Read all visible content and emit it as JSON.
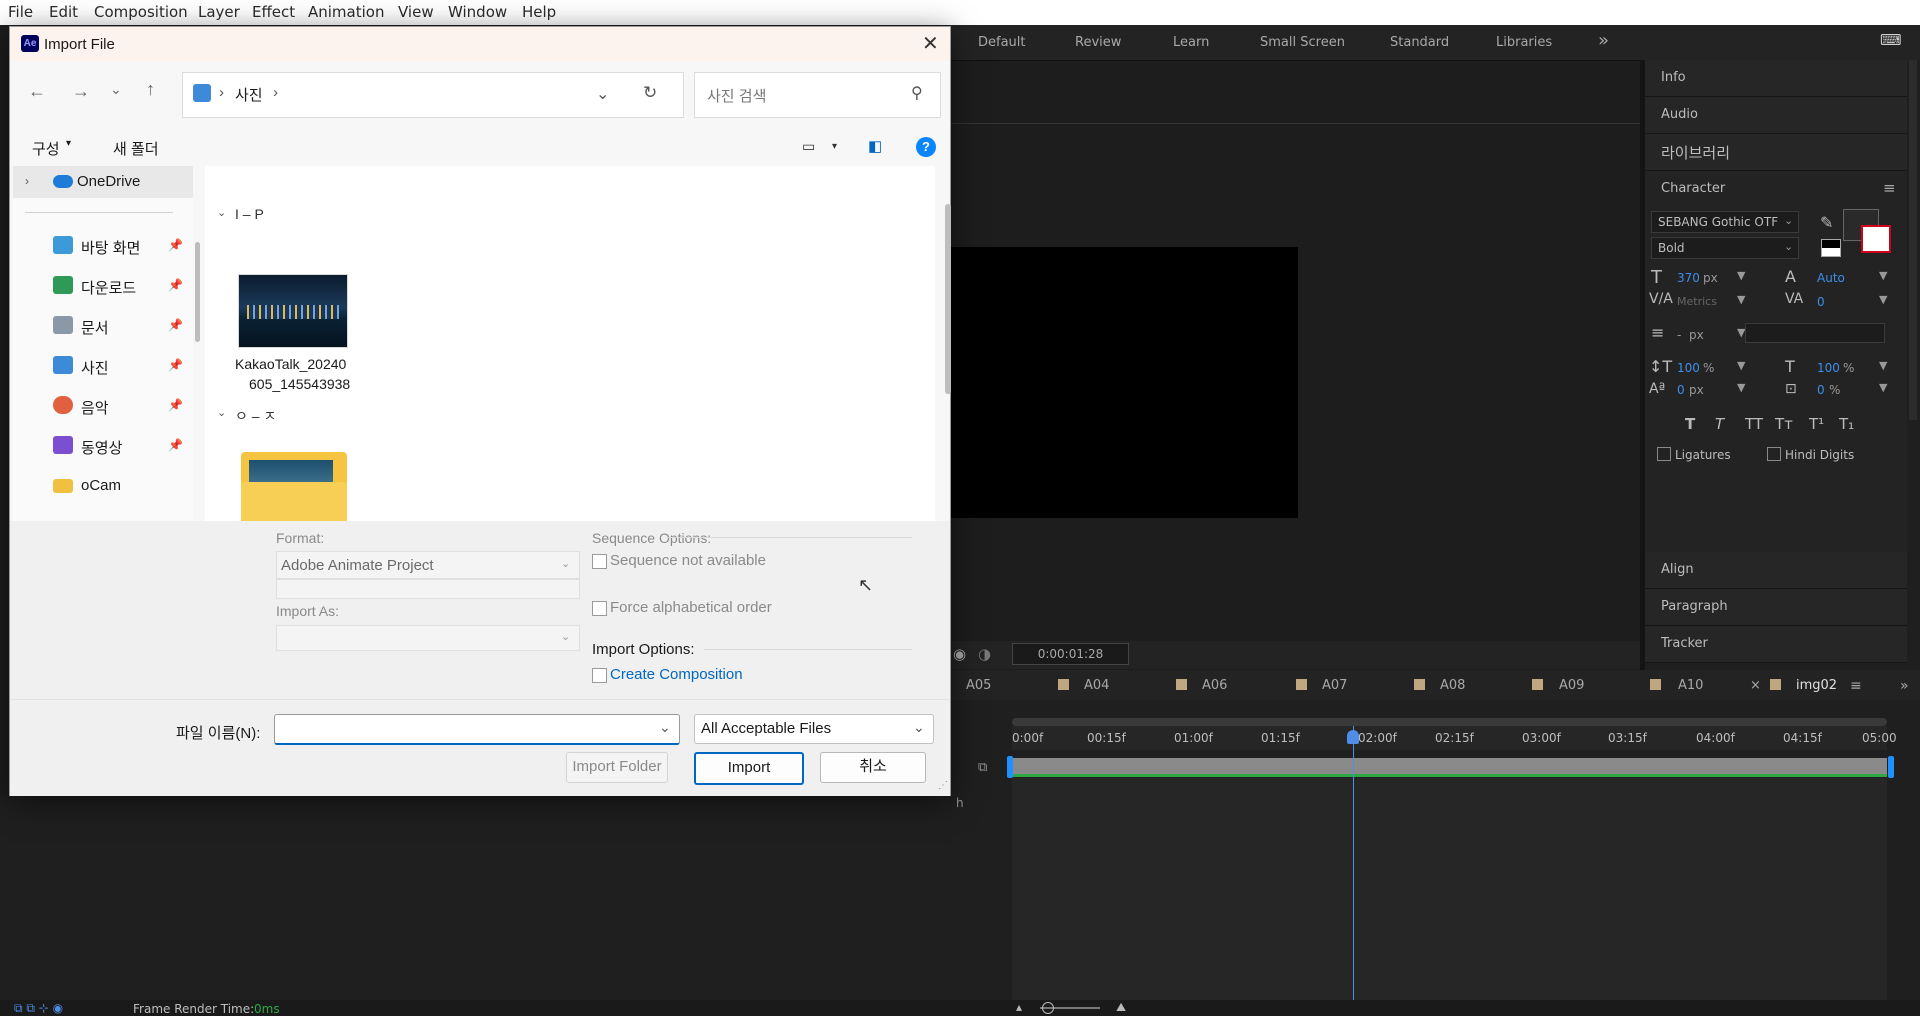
{
  "menubar": {
    "items": [
      "File",
      "Edit",
      "Composition",
      "Layer",
      "Effect",
      "Animation",
      "View",
      "Window",
      "Help"
    ]
  },
  "workspaces": {
    "items": [
      "Default",
      "Review",
      "Learn",
      "Small Screen",
      "Standard",
      "Libraries"
    ],
    "overflow_icon": "double-chevron-right"
  },
  "right_panels": {
    "info": "Info",
    "audio": "Audio",
    "libraries": "라이브러리",
    "character": "Character",
    "align": "Align",
    "paragraph": "Paragraph",
    "tracker": "Tracker"
  },
  "character": {
    "font_family": "SEBANG Gothic OTF",
    "font_style": "Bold",
    "font_size": "370",
    "font_size_unit": "px",
    "leading": "Auto",
    "kerning": "Metrics",
    "tracking": "0",
    "stroke_width": "-",
    "stroke_unit": "px",
    "vertical_scale": "100",
    "horizontal_scale": "100",
    "baseline_shift": "0",
    "baseline_unit": "px",
    "tsume": "0",
    "percent": "%",
    "ligatures": "Ligatures",
    "hindi_digits": "Hindi Digits",
    "style_buttons": [
      "T",
      "T",
      "TT",
      "Tт",
      "T¹",
      "T₁"
    ]
  },
  "dialog": {
    "title": "Import File",
    "breadcrumb_location": "사진",
    "search_placeholder": "사진 검색",
    "organize": "구성",
    "new_folder": "새 폴더",
    "nav_items": [
      {
        "label": "OneDrive",
        "icon": "cloud-icon",
        "color": "#1e7bd8"
      },
      {
        "label": "바탕 화면",
        "icon": "desktop-icon",
        "color": "#3c9ad8"
      },
      {
        "label": "다운로드",
        "icon": "download-icon",
        "color": "#2f9a58"
      },
      {
        "label": "문서",
        "icon": "document-icon",
        "color": "#8a98a8"
      },
      {
        "label": "사진",
        "icon": "pictures-icon",
        "color": "#3c8ad8"
      },
      {
        "label": "음악",
        "icon": "music-icon",
        "color": "#e06040"
      },
      {
        "label": "동영상",
        "icon": "video-icon",
        "color": "#7b4fd0"
      },
      {
        "label": "oCam",
        "icon": "folder-icon",
        "color": "#f0c040"
      }
    ],
    "groups": [
      {
        "label": "I – P"
      },
      {
        "label": "ㅇ – ㅈ"
      }
    ],
    "files": [
      {
        "name_line1": "KakaoTalk_20240",
        "name_line2": "605_145543938"
      }
    ],
    "format_label": "Format:",
    "format_value": "Adobe Animate Project",
    "import_as_label": "Import As:",
    "sequence_options_label": "Sequence Options:",
    "sequence_not_available": "Sequence not available",
    "force_alpha": "Force alphabetical order",
    "import_options_label": "Import Options:",
    "create_composition": "Create Composition",
    "filename_label": "파일 이름(N):",
    "filename_value": "",
    "filetype_value": "All Acceptable Files",
    "import_folder_btn": "Import Folder",
    "import_btn": "Import",
    "cancel_btn": "취소",
    "accent": "#0067c0"
  },
  "preview": {
    "timecode": "0:00:01:28"
  },
  "timeline": {
    "tabs": [
      "A05",
      "A04",
      "A06",
      "A07",
      "A08",
      "A09",
      "A10"
    ],
    "active_tab": "img02",
    "ruler": [
      "0:00f",
      "00:15f",
      "01:00f",
      "01:15f",
      "02:00f",
      "02:15f",
      "03:00f",
      "03:15f",
      "04:00f",
      "04:15f",
      "05:00"
    ],
    "playhead_fraction": 0.39,
    "col_label": "h"
  },
  "statusbar": {
    "label": "Frame Render Time:",
    "value": "0ms"
  }
}
